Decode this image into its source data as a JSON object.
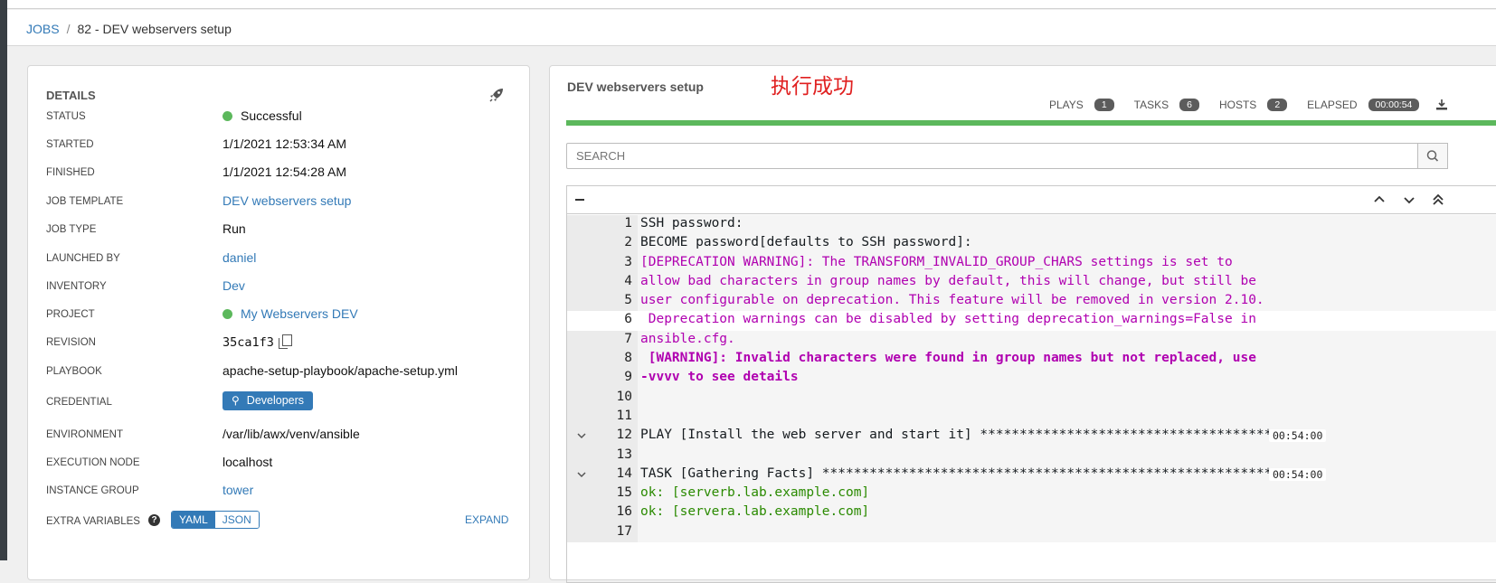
{
  "breadcrumb": {
    "jobs": "JOBS",
    "sep": "/",
    "current": "82 - DEV webservers setup"
  },
  "details": {
    "title": "DETAILS",
    "rows": [
      {
        "label": "STATUS",
        "value": "Successful"
      },
      {
        "label": "STARTED",
        "value": "1/1/2021 12:53:34 AM"
      },
      {
        "label": "FINISHED",
        "value": "1/1/2021 12:54:28 AM"
      },
      {
        "label": "JOB TEMPLATE",
        "value": "DEV webservers setup"
      },
      {
        "label": "JOB TYPE",
        "value": "Run"
      },
      {
        "label": "LAUNCHED BY",
        "value": "daniel"
      },
      {
        "label": "INVENTORY",
        "value": "Dev"
      },
      {
        "label": "PROJECT",
        "value": "My Webservers DEV"
      },
      {
        "label": "REVISION",
        "value": "35ca1f3"
      },
      {
        "label": "PLAYBOOK",
        "value": "apache-setup-playbook/apache-setup.yml"
      },
      {
        "label": "CREDENTIAL",
        "value": "Developers"
      },
      {
        "label": "ENVIRONMENT",
        "value": "/var/lib/awx/venv/ansible"
      },
      {
        "label": "EXECUTION NODE",
        "value": "localhost"
      },
      {
        "label": "INSTANCE GROUP",
        "value": "tower"
      },
      {
        "label": "EXTRA VARIABLES",
        "value": ""
      }
    ],
    "yaml": "YAML",
    "json": "JSON",
    "expand": "EXPAND",
    "status_color": "#5cb85c"
  },
  "output": {
    "title": "DEV webservers setup",
    "annotation": "执行成功",
    "stats": {
      "plays_label": "PLAYS",
      "plays": "1",
      "tasks_label": "TASKS",
      "tasks": "6",
      "hosts_label": "HOSTS",
      "hosts": "2",
      "elapsed_label": "ELAPSED",
      "elapsed": "00:00:54"
    },
    "search_placeholder": "SEARCH",
    "lines": [
      {
        "n": "1",
        "text": "SSH password:",
        "style": "norm"
      },
      {
        "n": "2",
        "text": "BECOME password[defaults to SSH password]:",
        "style": "norm"
      },
      {
        "n": "3",
        "text": "[DEPRECATION WARNING]: The TRANSFORM_INVALID_GROUP_CHARS settings is set to",
        "style": "warn"
      },
      {
        "n": "4",
        "text": "allow bad characters in group names by default, this will change, but still be",
        "style": "warn"
      },
      {
        "n": "5",
        "text": "user configurable on deprecation. This feature will be removed in version 2.10.",
        "style": "warn"
      },
      {
        "n": "6",
        "text": " Deprecation warnings can be disabled by setting deprecation_warnings=False in",
        "style": "warn"
      },
      {
        "n": "7",
        "text": "ansible.cfg.",
        "style": "warn"
      },
      {
        "n": "8",
        "text": " [WARNING]: Invalid characters were found in group names but not replaced, use",
        "style": "bold"
      },
      {
        "n": "9",
        "text": "-vvvv to see details",
        "style": "bold"
      },
      {
        "n": "10",
        "text": "",
        "style": "norm"
      },
      {
        "n": "11",
        "text": "",
        "style": "norm"
      },
      {
        "n": "12",
        "text": "PLAY [Install the web server and start it] *************************************",
        "style": "norm",
        "ts": "00:54:00"
      },
      {
        "n": "13",
        "text": "",
        "style": "norm"
      },
      {
        "n": "14",
        "text": "TASK [Gathering Facts] *********************************************************",
        "style": "norm",
        "ts": "00:54:00"
      },
      {
        "n": "15",
        "text": "ok: [serverb.lab.example.com]",
        "style": "ok"
      },
      {
        "n": "16",
        "text": "ok: [servera.lab.example.com]",
        "style": "ok"
      },
      {
        "n": "17",
        "text": "",
        "style": "norm"
      }
    ]
  }
}
